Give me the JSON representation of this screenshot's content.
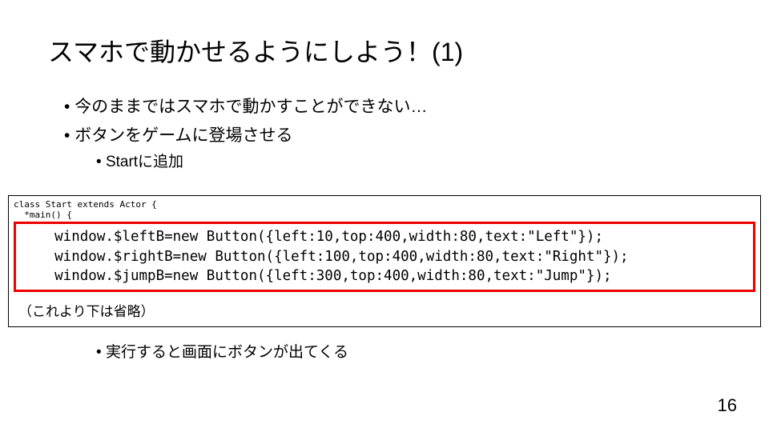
{
  "title": "スマホで動かせるようにしよう！(1)",
  "bullets": {
    "b1": "今のままではスマホで動かすことができない…",
    "b2": "ボタンをゲームに登場させる",
    "b3": "Startに追加",
    "b4": "実行すると画面にボタンが出てくる"
  },
  "code": {
    "header1": "class Start extends Actor {",
    "header2": "  *main() {",
    "line1": "    window.$leftB=new Button({left:10,top:400,width:80,text:\"Left\"});",
    "line2": "    window.$rightB=new Button({left:100,top:400,width:80,text:\"Right\"});",
    "line3": "    window.$jumpB=new Button({left:300,top:400,width:80,text:\"Jump\"});",
    "note": "（これより下は省略）"
  },
  "pagenum": "16"
}
